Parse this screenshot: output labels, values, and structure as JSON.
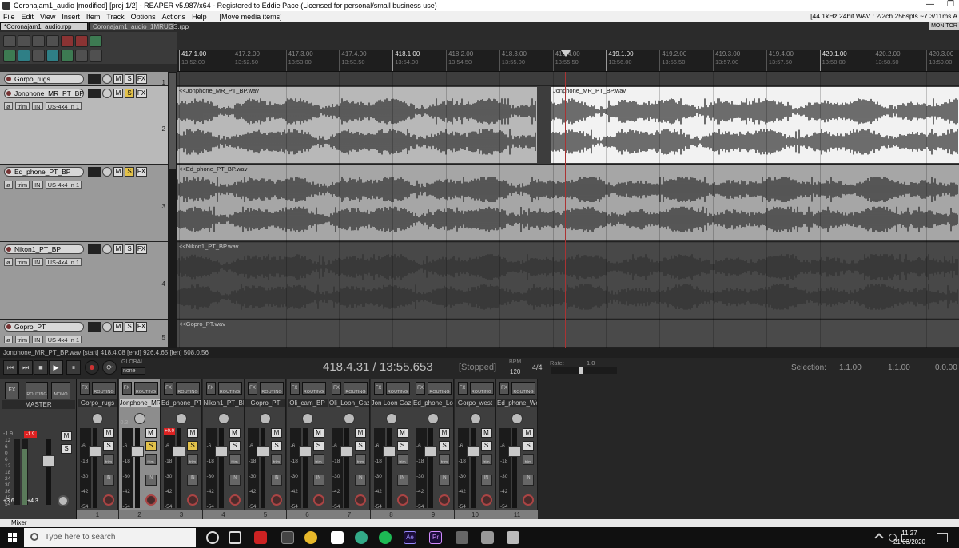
{
  "window": {
    "title": "Coronajam1_audio [modified] [proj 1/2] - REAPER v5.987/x64 - Registered to Eddie Pace (Licensed for personal/small business use)",
    "min_glyph": "—",
    "max_glyph": "❐"
  },
  "menu": {
    "items": [
      "File",
      "Edit",
      "View",
      "Insert",
      "Item",
      "Track",
      "Options",
      "Actions",
      "Help",
      "[Move media items]"
    ],
    "status": "[44.1kHz 24bit WAV : 2/2ch 256spls ~7.3/11ms A"
  },
  "tabs": {
    "active": "*Coronajam1_audio.rpp",
    "inactive": "Coronajam1_audio_1MRUGS.rpp",
    "monitor": "MONITOR"
  },
  "ruler": {
    "marks": [
      {
        "bar": "417.1.00",
        "time": "13:52.00",
        "major": true
      },
      {
        "bar": "417.2.00",
        "time": "13:52.50",
        "major": false
      },
      {
        "bar": "417.3.00",
        "time": "13:53.00",
        "major": false
      },
      {
        "bar": "417.4.00",
        "time": "13:53.50",
        "major": false
      },
      {
        "bar": "418.1.00",
        "time": "13:54.00",
        "major": true
      },
      {
        "bar": "418.2.00",
        "time": "13:54.50",
        "major": false
      },
      {
        "bar": "418.3.00",
        "time": "13:55.00",
        "major": false
      },
      {
        "bar": "418.4.00",
        "time": "13:55.50",
        "major": false
      },
      {
        "bar": "419.1.00",
        "time": "13:56.00",
        "major": true
      },
      {
        "bar": "419.2.00",
        "time": "13:56.50",
        "major": false
      },
      {
        "bar": "419.3.00",
        "time": "13:57.00",
        "major": false
      },
      {
        "bar": "419.4.00",
        "time": "13:57.50",
        "major": false
      },
      {
        "bar": "420.1.00",
        "time": "13:58.00",
        "major": true
      },
      {
        "bar": "420.2.00",
        "time": "13:58.50",
        "major": false
      },
      {
        "bar": "420.3.00",
        "time": "13:59.00",
        "major": false
      }
    ]
  },
  "tracks": [
    {
      "name": "Gorpo_rugs",
      "num": "1",
      "solo": false,
      "selected": false,
      "input": "",
      "item": "",
      "item_b": ""
    },
    {
      "name": "Jonphone_MR_PT_BP",
      "num": "2",
      "solo": true,
      "selected": true,
      "input": "US-4x4 In 1",
      "item": "<<Jonphone_MR_PT_BP.wav",
      "item_b": "Jonphone_MR_PT_BP.wav"
    },
    {
      "name": "Ed_phone_PT_BP",
      "num": "3",
      "solo": true,
      "selected": false,
      "input": "US-4x4 In 1",
      "item": "<<Ed_phone_PT_BP.wav",
      "item_b": ""
    },
    {
      "name": "Nikon1_PT_BP",
      "num": "4",
      "solo": false,
      "selected": false,
      "input": "US-4x4 In 1",
      "item": "<<Nikon1_PT_BP.wav",
      "item_b": ""
    },
    {
      "name": "Gopro_PT",
      "num": "5",
      "solo": false,
      "selected": false,
      "input": "US-4x4 In 1",
      "item": "<<Gopro_PT.wav",
      "item_b": ""
    }
  ],
  "tcp_labels": {
    "mute": "M",
    "solo": "S",
    "fx": "FX",
    "trim": "trim",
    "in": "IN"
  },
  "status_line": "Jonphone_MR_PT_BP.wav [start] 418.4.08 [end] 926.4.65 [len] 508.0.56",
  "transport": {
    "position": "418.4.31 / 13:55.653",
    "state": "[Stopped]",
    "bpm_label": "BPM",
    "bpm": "120",
    "signature": "4/4",
    "rate_label": "Rate:",
    "rate": "1.0",
    "rate_level": 0.45,
    "global_label": "GLOBAL",
    "global_value": "none",
    "selection_label": "Selection:",
    "selection_start": "1.1.00",
    "selection_end": "1.1.00",
    "selection_len": "0.0.00",
    "buttons": {
      "rewind": "⏮",
      "forward": "⏭",
      "stop": "■",
      "play": "▶",
      "pause": "⏸",
      "record": "●",
      "repeat": "⟳"
    }
  },
  "mixer": {
    "master": {
      "name": "MASTER",
      "peak_l": "-1.9",
      "peak_r": "-1.9",
      "vol_l": "+3.6",
      "vol_r": "+4.3",
      "mono": "MONO",
      "routing": "ROUTING",
      "fx": "FX"
    },
    "scale": [
      "12",
      "6",
      "0",
      "6",
      "12",
      "18",
      "24",
      "30",
      "36",
      "42",
      "54"
    ],
    "strip_scale": [
      "-6",
      "-18",
      "-30",
      "-42",
      "-54"
    ],
    "routing_label": "ROUTING",
    "fx_label": "FX",
    "trim_label": "trim",
    "in_label": "IN",
    "strips": [
      {
        "name": "Gorpo_rugs",
        "num": "1",
        "solo": false,
        "selected": false,
        "clip": "",
        "peak": ""
      },
      {
        "name": "Jonphone_MR",
        "num": "2",
        "solo": true,
        "selected": true,
        "clip": "",
        "peak": "0.3"
      },
      {
        "name": "Ed_phone_PT",
        "num": "3",
        "solo": true,
        "selected": false,
        "clip": "+0.0",
        "peak": ""
      },
      {
        "name": "Nikon1_PT_BF",
        "num": "4",
        "solo": false,
        "selected": false,
        "clip": "",
        "peak": ""
      },
      {
        "name": "Gopro_PT",
        "num": "5",
        "solo": false,
        "selected": false,
        "clip": "",
        "peak": ""
      },
      {
        "name": "Oli_cam_BP",
        "num": "6",
        "solo": false,
        "selected": false,
        "clip": "",
        "peak": ""
      },
      {
        "name": "Oli_Loon_Gaz",
        "num": "7",
        "solo": false,
        "selected": false,
        "clip": "",
        "peak": ""
      },
      {
        "name": "Jon Loon Gaz",
        "num": "8",
        "solo": false,
        "selected": false,
        "clip": "",
        "peak": ""
      },
      {
        "name": "Ed_phone_Loc",
        "num": "9",
        "solo": false,
        "selected": false,
        "clip": "",
        "peak": ""
      },
      {
        "name": "Gorpo_west",
        "num": "10",
        "solo": false,
        "selected": false,
        "clip": "",
        "peak": ""
      },
      {
        "name": "Ed_phone_We",
        "num": "11",
        "solo": false,
        "selected": false,
        "clip": "",
        "peak": ""
      }
    ]
  },
  "docker": {
    "label": "Mixer"
  },
  "taskbar": {
    "search_placeholder": "Type here to search",
    "time": "11:27",
    "date": "21/03/2020",
    "ae_label": "Ae",
    "pr_label": "Pr"
  },
  "colors": {
    "solo_on": "#e3c24a",
    "clip": "#dd2222",
    "playhead": "#aa3333",
    "wave": "#333333",
    "selected_item": "#f2f2f2"
  }
}
